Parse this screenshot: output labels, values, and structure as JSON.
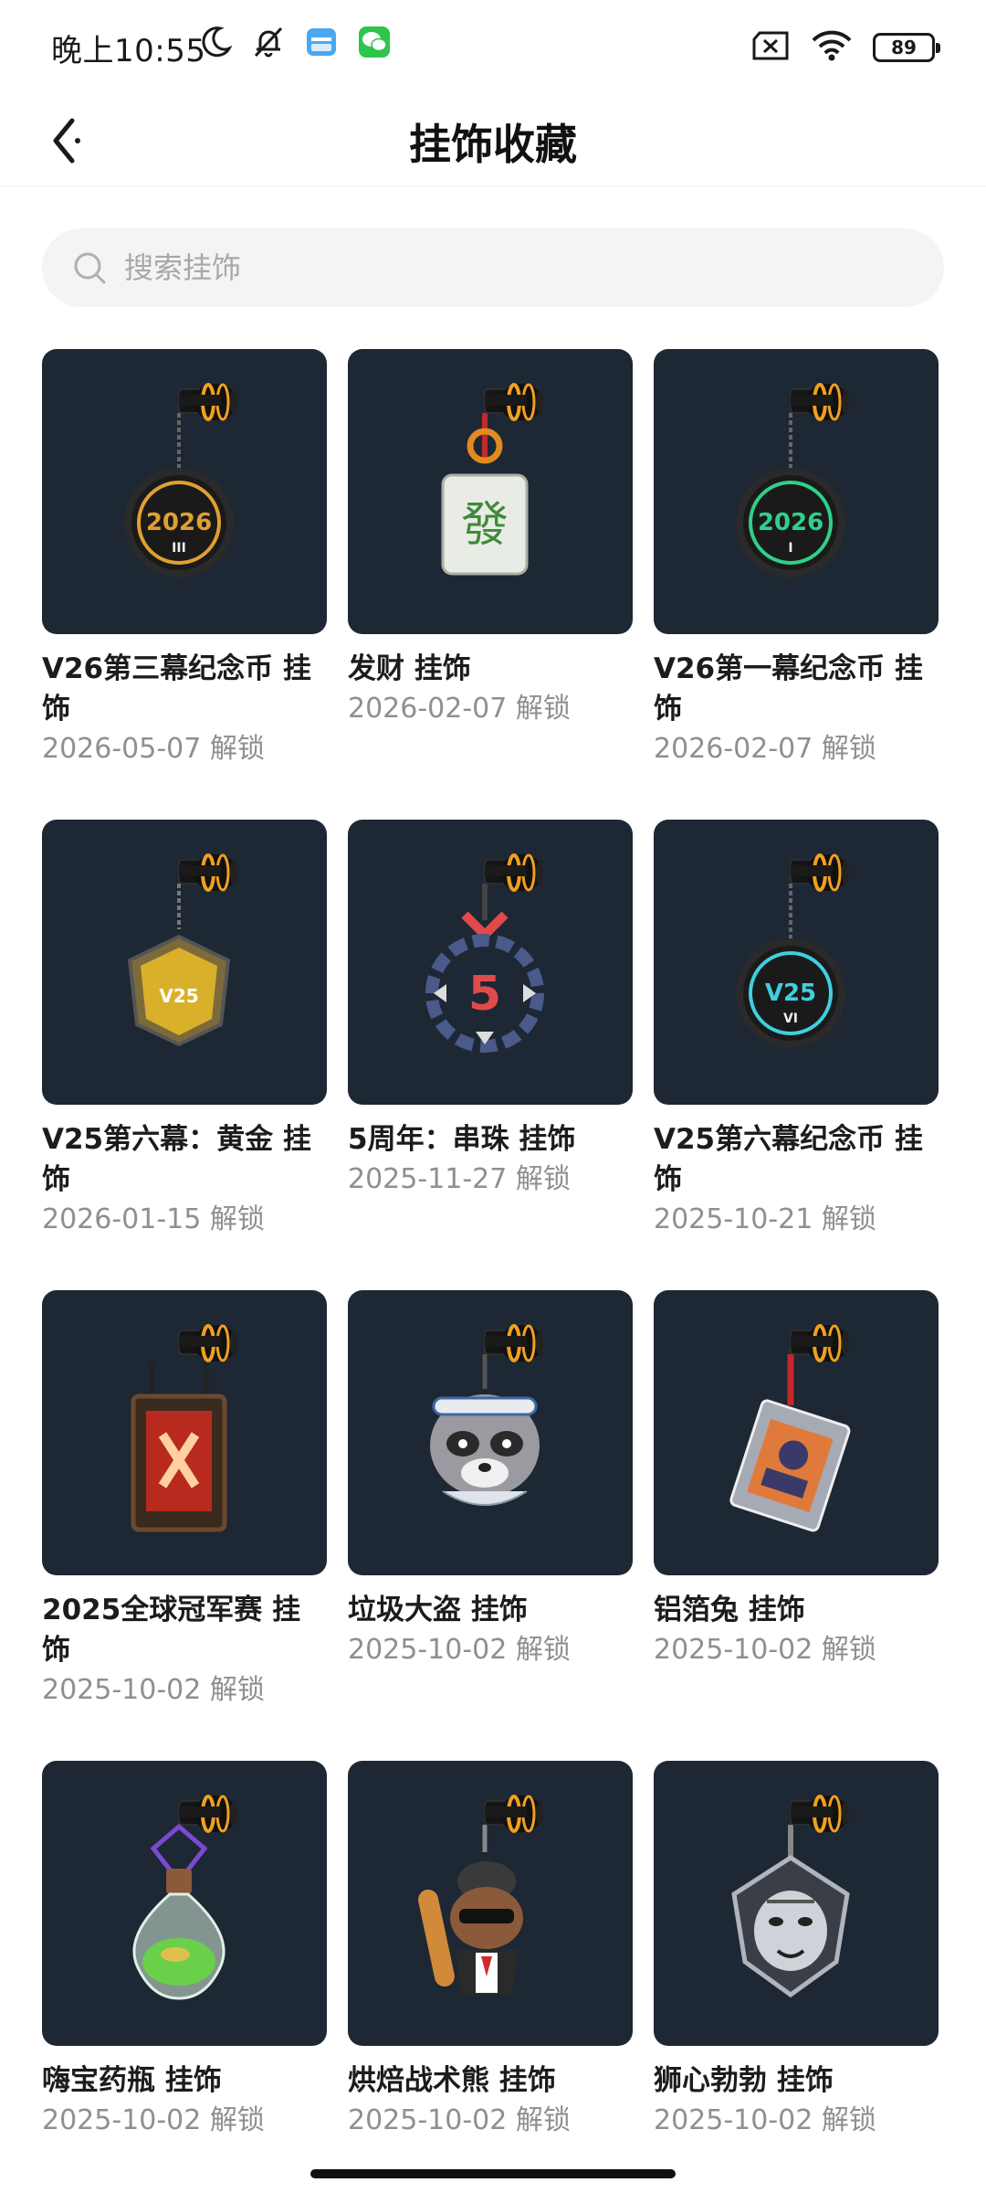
{
  "status_bar": {
    "time": "晚上10:55",
    "battery": "89",
    "icons": [
      "moon-icon",
      "bell-off-icon",
      "card-app-icon",
      "wechat-icon",
      "no-sim-icon",
      "wifi-icon",
      "battery-icon"
    ]
  },
  "header": {
    "title": "挂饰收藏",
    "back_icon": "back-arrow-icon"
  },
  "search": {
    "placeholder": "搜索挂饰",
    "icon": "search-icon"
  },
  "items": [
    {
      "name": "V26第三幕纪念币 挂饰",
      "date": "2026-05-07 解锁",
      "art": "coin",
      "color": "#e0a030",
      "label": "2026",
      "sub": "III"
    },
    {
      "name": "发财 挂饰",
      "date": "2026-02-07 解锁",
      "art": "mahjong",
      "color": "#3e8a3a",
      "label": "發",
      "sub": ""
    },
    {
      "name": "V26第一幕纪念币 挂饰",
      "date": "2026-02-07 解锁",
      "art": "coin",
      "color": "#2fd08a",
      "label": "2026",
      "sub": "I"
    },
    {
      "name": "V25第六幕：黄金 挂饰",
      "date": "2026-01-15 解锁",
      "art": "shield",
      "color": "#d9b02a",
      "label": "V25",
      "sub": ""
    },
    {
      "name": "5周年：串珠 挂饰",
      "date": "2025-11-27 解锁",
      "art": "ring",
      "color": "#e14a4a",
      "label": "5",
      "sub": ""
    },
    {
      "name": "V25第六幕纪念币 挂饰",
      "date": "2025-10-21 解锁",
      "art": "coin",
      "color": "#3fd0e0",
      "label": "V25",
      "sub": "VI"
    },
    {
      "name": "2025全球冠军赛 挂饰",
      "date": "2025-10-02 解锁",
      "art": "banner",
      "color": "#e03a2a",
      "label": "",
      "sub": ""
    },
    {
      "name": "垃圾大盗 挂饰",
      "date": "2025-10-02 解锁",
      "art": "raccoon",
      "color": "#9a9aa0",
      "label": "",
      "sub": ""
    },
    {
      "name": "铝箔兔 挂饰",
      "date": "2025-10-02 解锁",
      "art": "card",
      "color": "#e07a3a",
      "label": "",
      "sub": ""
    },
    {
      "name": "嗨宝药瓶 挂饰",
      "date": "2025-10-02 解锁",
      "art": "bottle",
      "color": "#6ad04a",
      "label": "",
      "sub": ""
    },
    {
      "name": "烘焙战术熊 挂饰",
      "date": "2025-10-02 解锁",
      "art": "bear",
      "color": "#8a5a3a",
      "label": "",
      "sub": ""
    },
    {
      "name": "狮心勃勃 挂饰",
      "date": "2025-10-02 解锁",
      "art": "lion",
      "color": "#b0b4bc",
      "label": "",
      "sub": ""
    }
  ]
}
